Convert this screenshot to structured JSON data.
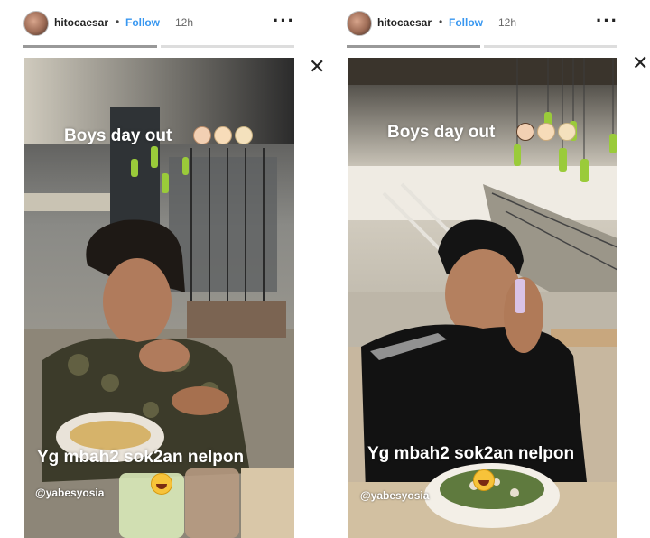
{
  "stories": [
    {
      "header": {
        "username": "hitocaesar",
        "separator": "•",
        "follow_label": "Follow",
        "time": "12h",
        "more_icon": "more-icon"
      },
      "close_icon": "close-icon",
      "caption_top": "Boys day out",
      "caption_bottom": "Yg mbah2 sok2an nelpon",
      "mention": "@yabesyosia",
      "progress": [
        1,
        0
      ]
    },
    {
      "header": {
        "username": "hitocaesar",
        "separator": "•",
        "follow_label": "Follow",
        "time": "12h",
        "more_icon": "more-icon"
      },
      "close_icon": "close-icon",
      "caption_top": "Boys day out",
      "caption_bottom": "Yg mbah2 sok2an nelpon",
      "mention": "@yabesyosia",
      "progress": [
        1,
        0
      ]
    }
  ],
  "colors": {
    "follow": "#3897f0",
    "progress_done": "#999999",
    "progress_todo": "#dddddd"
  }
}
